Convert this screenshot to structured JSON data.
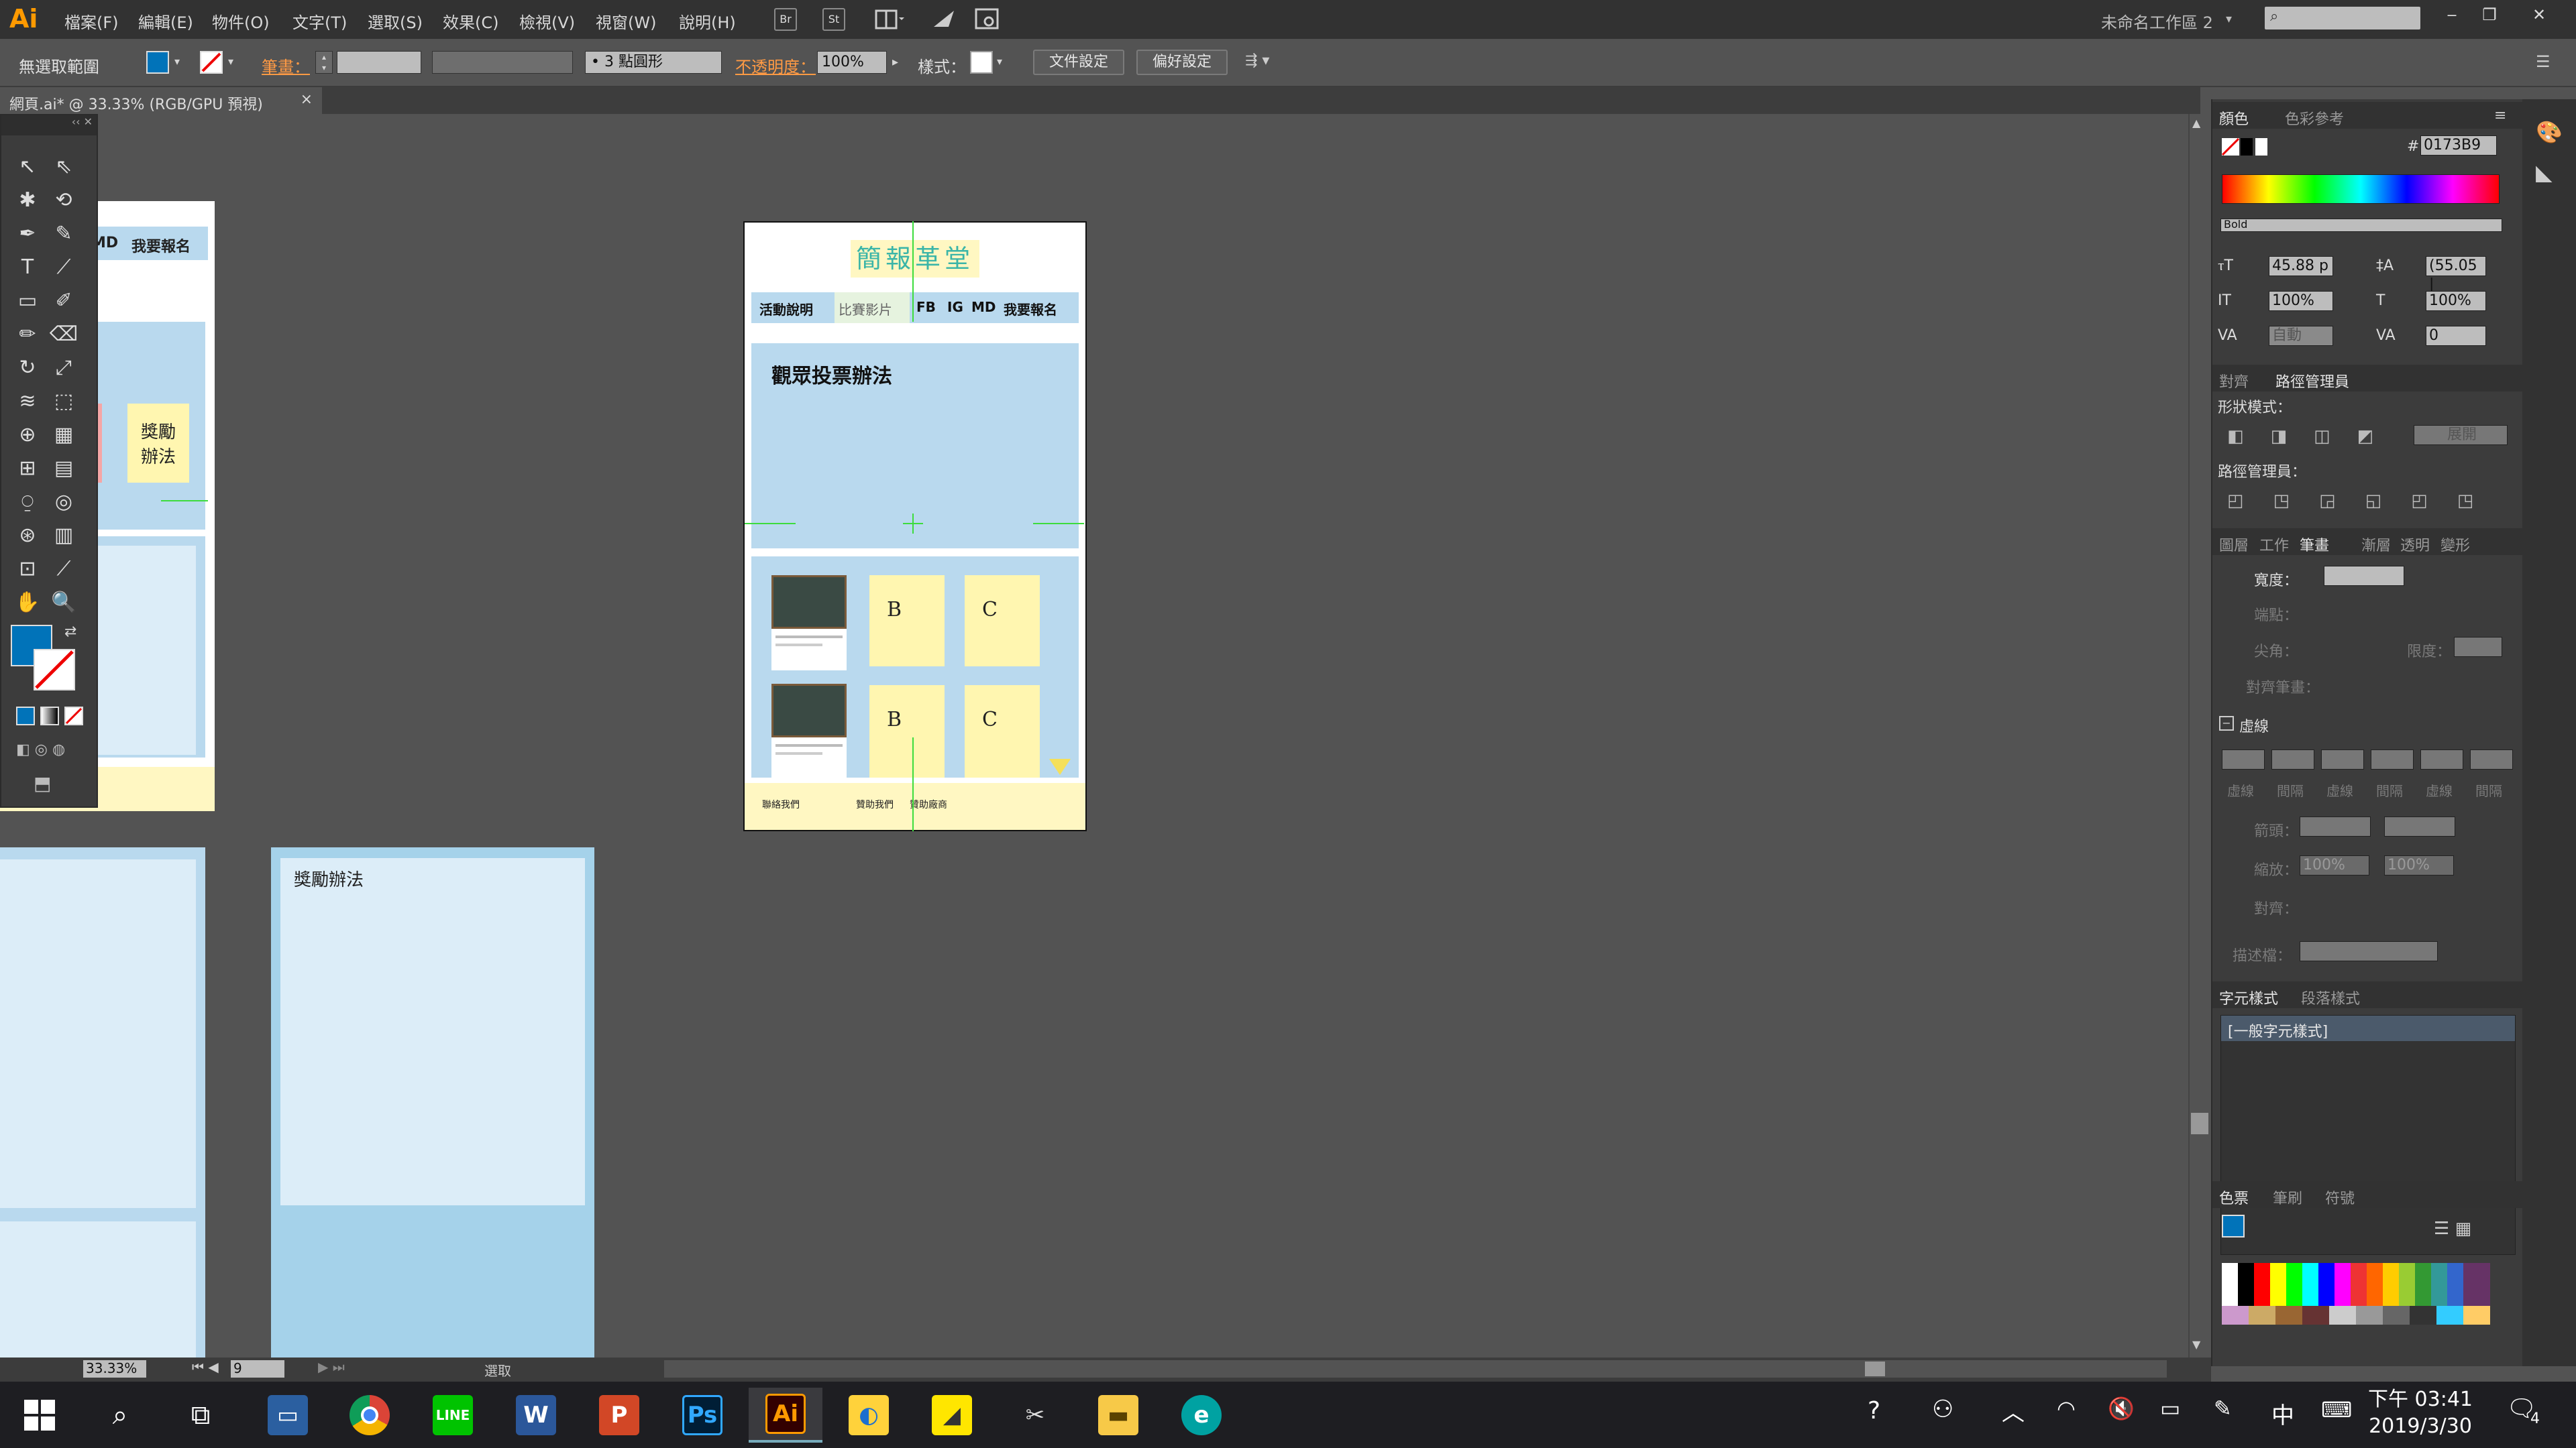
{
  "app": {
    "logo": "Ai"
  },
  "menu": [
    "檔案(F)",
    "編輯(E)",
    "物件(O)",
    "文字(T)",
    "選取(S)",
    "效果(C)",
    "檢視(V)",
    "視窗(W)",
    "說明(H)"
  ],
  "menubar_buttons": [
    "Br",
    "St"
  ],
  "workspace": "未命名工作區 2",
  "control": {
    "no_selection": "無選取範圍",
    "stroke_label": "筆畫：",
    "brush": "3 點圓形",
    "opacity_label": "不透明度：",
    "opacity_value": "100%",
    "style_label": "樣式：",
    "doc_setup": "文件設定",
    "preferences": "偏好設定"
  },
  "doc_tab": {
    "title": "網頁.ai* @ 33.33% (RGB/GPU 預視)",
    "close": "×"
  },
  "artboard": {
    "title": "簡報革堂",
    "nav": [
      "活動說明",
      "比賽影片",
      "FB",
      "IG",
      "MD",
      "我要報名"
    ],
    "section_title": "觀眾投票辦法",
    "cards": [
      "B",
      "C",
      "B",
      "C"
    ],
    "footer": [
      "聯絡我們",
      "贊助我們",
      "贊助廠商"
    ]
  },
  "left_fragment": {
    "nav": [
      "MD",
      "我要報名"
    ],
    "award": "獎勵\n辦法"
  },
  "bottom_box": {
    "label": "獎勵辦法"
  },
  "panels": {
    "color_tabs": [
      "顏色",
      "色彩參考"
    ],
    "hex_label": "#",
    "hex_value": "0173B9",
    "font_style": "Bold",
    "char": {
      "size": "45.88 p",
      "leading": "(55.05 |",
      "vscale": "100%",
      "hscale": "100%",
      "kerning": "自動",
      "tracking": "0"
    },
    "pathfinder_tabs": [
      "對齊",
      "路徑管理員"
    ],
    "shape_modes": "形狀模式：",
    "expand": "展開",
    "pathfinders": "路徑管理員：",
    "stroke_tabs": [
      "圖層",
      "工作",
      "筆畫",
      "漸層",
      "透明",
      "變形"
    ],
    "weight": "寬度：",
    "cap": "端點：",
    "corner": "尖角：",
    "limit": "限度：",
    "align_stroke": "對齊筆畫：",
    "dashed": "虛線",
    "dash_labels": [
      "虛線",
      "間隔",
      "虛線",
      "間隔",
      "虛線",
      "間隔"
    ],
    "arrows": "箭頭：",
    "scale": "縮放：",
    "scale_a": "100%",
    "scale_b": "100%",
    "align": "對齊：",
    "profile": "描述檔：",
    "charstyle_tabs": [
      "字元樣式",
      "段落樣式"
    ],
    "charstyle_item": "[一般字元樣式]",
    "swatch_tabs": [
      "色票",
      "筆刷",
      "符號"
    ]
  },
  "status": {
    "zoom": "33.33%",
    "artboard_num": "9",
    "tool": "選取"
  },
  "taskbar": {
    "time": "下午 03:41",
    "date": "2019/3/30",
    "notif": "4",
    "ime": "中"
  },
  "colors": {
    "accent": "#0173B9",
    "light_blue": "#b9d9ee",
    "pale_yellow": "#fff7c2",
    "yellow_card": "#fff6b0",
    "pink": "#f5a6a6"
  }
}
